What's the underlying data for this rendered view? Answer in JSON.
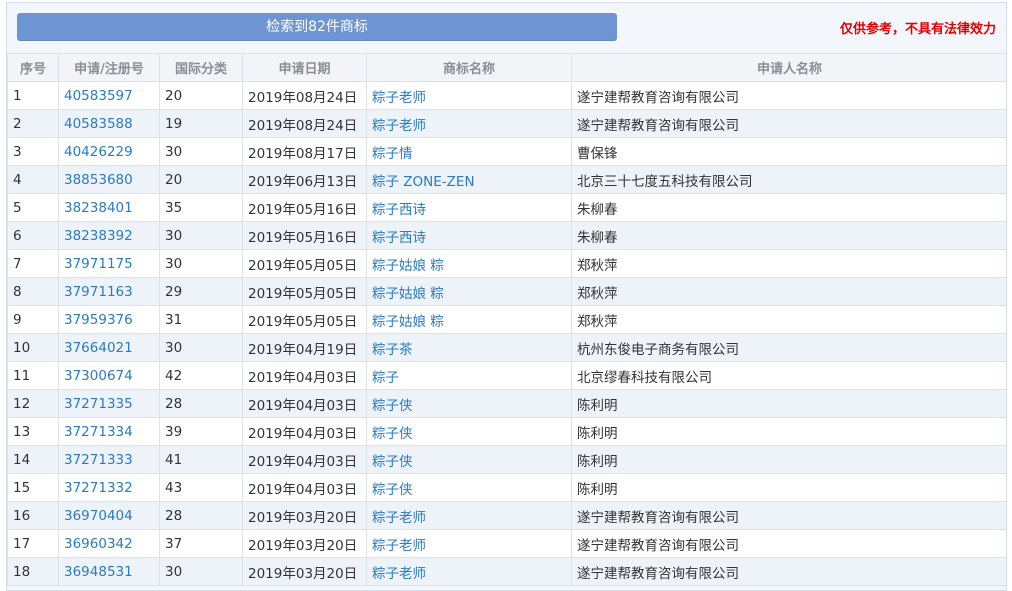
{
  "header": {
    "result_label": "检索到82件商标",
    "disclaimer": "仅供参考，不具有法律效力"
  },
  "table": {
    "columns": [
      "序号",
      "申请/注册号",
      "国际分类",
      "申请日期",
      "商标名称",
      "申请人名称"
    ],
    "rows": [
      [
        "1",
        "40583597",
        "20",
        "2019年08月24日",
        "粽子老师",
        "遂宁建帮教育咨询有限公司"
      ],
      [
        "2",
        "40583588",
        "19",
        "2019年08月24日",
        "粽子老师",
        "遂宁建帮教育咨询有限公司"
      ],
      [
        "3",
        "40426229",
        "30",
        "2019年08月17日",
        "粽子情",
        "曹保锋"
      ],
      [
        "4",
        "38853680",
        "20",
        "2019年06月13日",
        "粽子 ZONE-ZEN",
        "北京三十七度五科技有限公司"
      ],
      [
        "5",
        "38238401",
        "35",
        "2019年05月16日",
        "粽子西诗",
        "朱柳春"
      ],
      [
        "6",
        "38238392",
        "30",
        "2019年05月16日",
        "粽子西诗",
        "朱柳春"
      ],
      [
        "7",
        "37971175",
        "30",
        "2019年05月05日",
        "粽子姑娘 粽",
        "郑秋萍"
      ],
      [
        "8",
        "37971163",
        "29",
        "2019年05月05日",
        "粽子姑娘 粽",
        "郑秋萍"
      ],
      [
        "9",
        "37959376",
        "31",
        "2019年05月05日",
        "粽子姑娘 粽",
        "郑秋萍"
      ],
      [
        "10",
        "37664021",
        "30",
        "2019年04月19日",
        "粽子茶",
        "杭州东俊电子商务有限公司"
      ],
      [
        "11",
        "37300674",
        "42",
        "2019年04月03日",
        "粽子",
        "北京缪春科技有限公司"
      ],
      [
        "12",
        "37271335",
        "28",
        "2019年04月03日",
        "粽子侠",
        "陈利明"
      ],
      [
        "13",
        "37271334",
        "39",
        "2019年04月03日",
        "粽子侠",
        "陈利明"
      ],
      [
        "14",
        "37271333",
        "41",
        "2019年04月03日",
        "粽子侠",
        "陈利明"
      ],
      [
        "15",
        "37271332",
        "43",
        "2019年04月03日",
        "粽子侠",
        "陈利明"
      ],
      [
        "16",
        "36970404",
        "28",
        "2019年03月20日",
        "粽子老师",
        "遂宁建帮教育咨询有限公司"
      ],
      [
        "17",
        "36960342",
        "37",
        "2019年03月20日",
        "粽子老师",
        "遂宁建帮教育咨询有限公司"
      ],
      [
        "18",
        "36948531",
        "30",
        "2019年03月20日",
        "粽子老师",
        "遂宁建帮教育咨询有限公司"
      ]
    ]
  }
}
